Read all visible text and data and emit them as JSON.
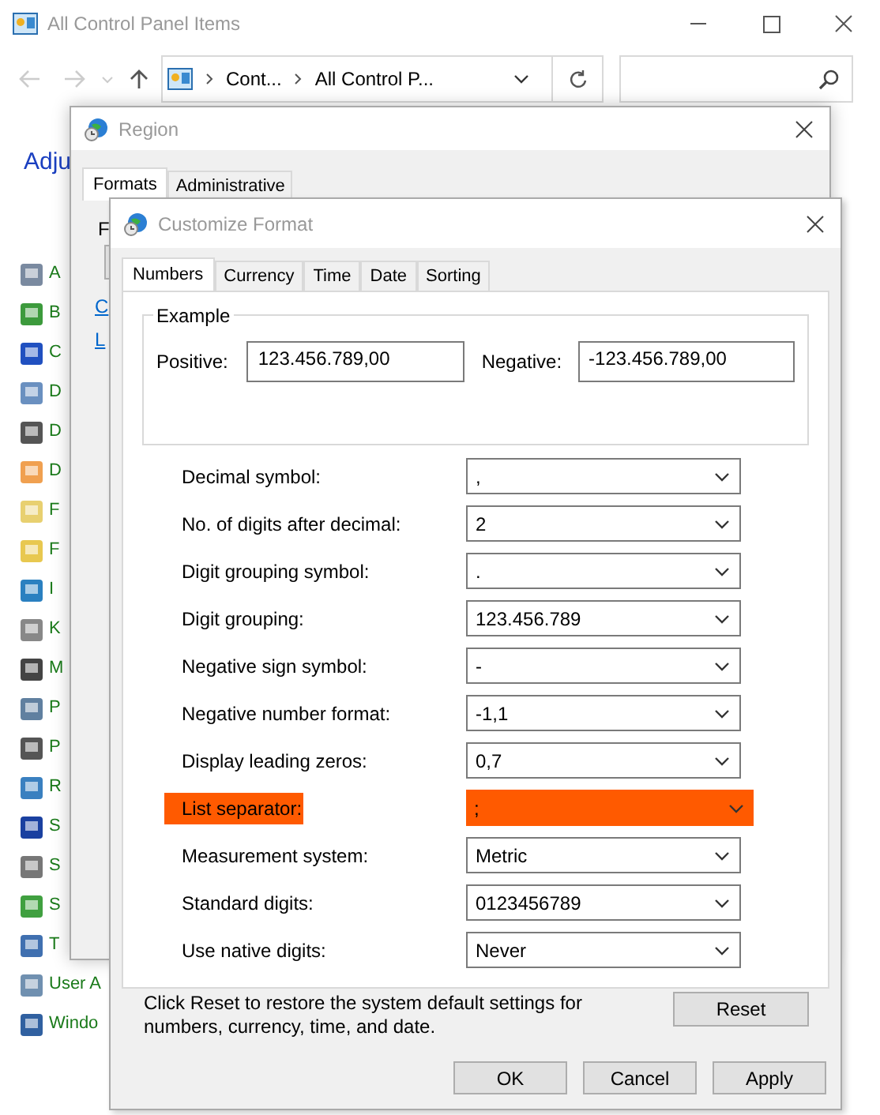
{
  "explorer": {
    "title": "All Control Panel Items",
    "breadcrumbs": [
      "Cont...",
      "All Control P..."
    ],
    "heading": "Adju",
    "items": [
      {
        "label": "A"
      },
      {
        "label": "B"
      },
      {
        "label": "C"
      },
      {
        "label": "D"
      },
      {
        "label": "D"
      },
      {
        "label": "D"
      },
      {
        "label": "F"
      },
      {
        "label": "F"
      },
      {
        "label": "I"
      },
      {
        "label": "K"
      },
      {
        "label": "M"
      },
      {
        "label": "P"
      },
      {
        "label": "P"
      },
      {
        "label": "R"
      },
      {
        "label": "S"
      },
      {
        "label": "S"
      },
      {
        "label": "S"
      },
      {
        "label": "T"
      },
      {
        "label": "User A"
      },
      {
        "label": "Windo"
      }
    ]
  },
  "region": {
    "title": "Region",
    "tabs": [
      {
        "label": "Formats",
        "selected": true
      },
      {
        "label": "Administrative",
        "selected": false
      }
    ],
    "label": "F",
    "links": [
      "C",
      "L"
    ]
  },
  "customize": {
    "title": "Customize Format",
    "tabs": [
      {
        "label": "Numbers",
        "selected": true
      },
      {
        "label": "Currency",
        "selected": false
      },
      {
        "label": "Time",
        "selected": false
      },
      {
        "label": "Date",
        "selected": false
      },
      {
        "label": "Sorting",
        "selected": false
      }
    ],
    "example": {
      "title": "Example",
      "positive_label": "Positive:",
      "positive": "123.456.789,00",
      "negative_label": "Negative:",
      "negative": "-123.456.789,00"
    },
    "rows": [
      {
        "label": "Decimal symbol:",
        "value": ",",
        "highlighted": false
      },
      {
        "label": "No. of digits after decimal:",
        "value": "2",
        "highlighted": false
      },
      {
        "label": "Digit grouping symbol:",
        "value": ".",
        "highlighted": false
      },
      {
        "label": "Digit grouping:",
        "value": "123.456.789",
        "highlighted": false
      },
      {
        "label": "Negative sign symbol:",
        "value": "-",
        "highlighted": false
      },
      {
        "label": "Negative number format:",
        "value": "-1,1",
        "highlighted": false
      },
      {
        "label": "Display leading zeros:",
        "value": "0,7",
        "highlighted": false
      },
      {
        "label": "List separator:",
        "value": ";",
        "highlighted": true
      },
      {
        "label": "Measurement system:",
        "value": "Metric",
        "highlighted": false
      },
      {
        "label": "Standard digits:",
        "value": "0123456789",
        "highlighted": false
      },
      {
        "label": "Use native digits:",
        "value": "Never",
        "highlighted": false
      }
    ],
    "note": "Click Reset to restore the system default settings for numbers, currency, time, and date.",
    "reset": "Reset",
    "buttons": [
      "OK",
      "Cancel",
      "Apply"
    ]
  }
}
